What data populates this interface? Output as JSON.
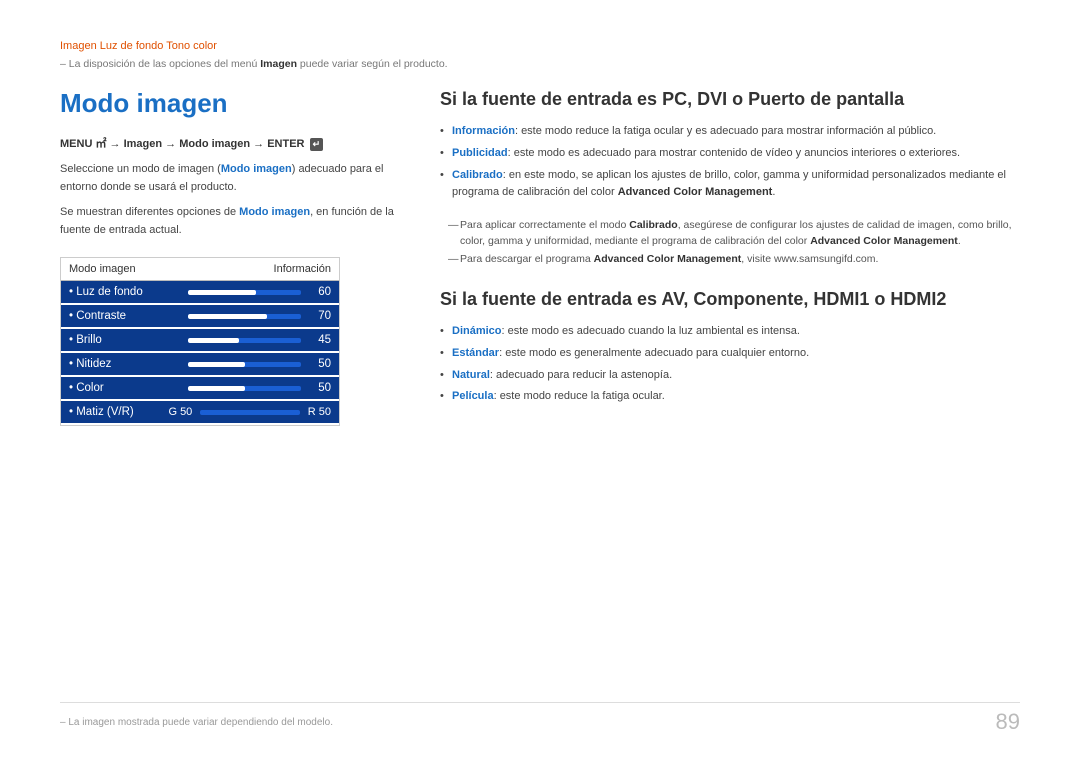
{
  "breadcrumb": {
    "text": "Imagen  Luz de fondo  Tono color",
    "note": "La disposición de las opciones del menú ",
    "note_bold": "Imagen",
    "note_end": " puede variar según el producto."
  },
  "left": {
    "title": "Modo imagen",
    "menu_path_prefix": "MENU ",
    "menu_path_arrow1": " → ",
    "menu_path_item1": "Imagen",
    "menu_path_arrow2": " → ",
    "menu_path_item2": "Modo imagen",
    "menu_path_arrow3": " → ENTER ",
    "desc1_before": "Seleccione un modo de imagen (",
    "desc1_bold": "Modo imagen",
    "desc1_after": ") adecuado para el entorno donde se usará el producto.",
    "desc2_before": "Se muestran diferentes opciones de ",
    "desc2_bold": "Modo imagen",
    "desc2_after": ", en función de la fuente de entrada actual.",
    "table": {
      "col1": "Modo imagen",
      "col2": "Información",
      "rows": [
        {
          "label": "• Luz de fondo",
          "value": "60",
          "bar_pct": 60
        },
        {
          "label": "• Contraste",
          "value": "70",
          "bar_pct": 70
        },
        {
          "label": "• Brillo",
          "value": "45",
          "bar_pct": 45
        },
        {
          "label": "• Nitidez",
          "value": "50",
          "bar_pct": 50
        },
        {
          "label": "• Color",
          "value": "50",
          "bar_pct": 50
        }
      ],
      "matiz": {
        "label": "• Matiz (V/R)",
        "g_label": "G 50",
        "r_label": "R 50"
      }
    }
  },
  "right": {
    "heading1": "Si la fuente de entrada es PC, DVI o Puerto de pantalla",
    "bullets1": [
      {
        "term": "Información",
        "text": ": este modo reduce la fatiga ocular y es adecuado para mostrar información al público."
      },
      {
        "term": "Publicidad",
        "text": ": este modo es adecuado para mostrar contenido de vídeo y anuncios interiores o exteriores."
      },
      {
        "term": "Calibrado",
        "text": ": en este modo, se aplican los ajustes de brillo, color, gamma y uniformidad personalizados mediante el programa de calibración del color ",
        "bold_end": "Advanced Color Management",
        "end": "."
      }
    ],
    "sub_notes": [
      {
        "before": "Para aplicar correctamente el modo ",
        "bold1": "Calibrado",
        "mid": ", asegúrese de configurar los ajustes de calidad de imagen, como brillo, color, gamma y uniformidad, mediante el programa de calibración del color ",
        "bold2": "Advanced Color Management",
        "after": "."
      },
      {
        "before": "Para descargar el programa ",
        "bold1": "Advanced Color Management",
        "after": ", visite www.samsungifd.com."
      }
    ],
    "heading2": "Si la fuente de entrada es AV, Componente, HDMI1 o HDMI2",
    "bullets2": [
      {
        "term": "Dinámico",
        "text": ": este modo es adecuado cuando la luz ambiental es intensa."
      },
      {
        "term": "Estándar",
        "text": ": este modo es generalmente adecuado para cualquier entorno."
      },
      {
        "term": "Natural",
        "text": ": adecuado para reducir la astenopía."
      },
      {
        "term": "Película",
        "text": ": este modo reduce la fatiga ocular."
      }
    ]
  },
  "footer": {
    "note_before": "La imagen mostrada puede variar dependiendo del modelo.",
    "page_number": "89"
  }
}
